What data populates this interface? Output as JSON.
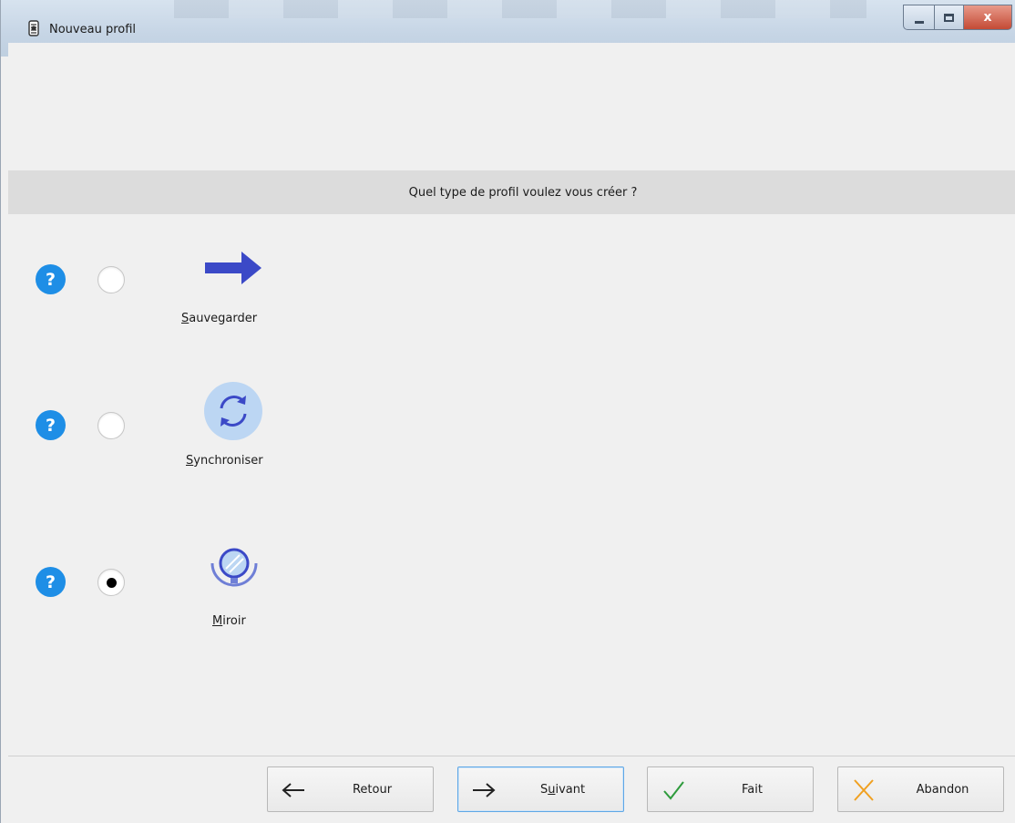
{
  "window": {
    "title": "Nouveau profil",
    "controls": {
      "close_glyph": "x"
    }
  },
  "question": "Quel type de profil voulez vous créer ?",
  "options": [
    {
      "id": "sauvegarder",
      "label_first": "S",
      "label_rest": "auvegarder",
      "icon": "arrow-right-icon",
      "selected": false
    },
    {
      "id": "synchroniser",
      "label_first": "S",
      "label_rest": "ynchroniser",
      "icon": "sync-icon",
      "selected": false
    },
    {
      "id": "miroir",
      "label_first": "M",
      "label_rest": "iroir",
      "icon": "mirror-icon",
      "selected": true
    }
  ],
  "help_glyph": "?",
  "buttons": {
    "back": {
      "label": "Retour",
      "icon": "arrow-left-icon"
    },
    "next": {
      "label_pre": "S",
      "label_u": "u",
      "label_post": "ivant",
      "icon": "arrow-right-icon"
    },
    "done": {
      "label": "Fait",
      "icon": "check-icon"
    },
    "abort": {
      "label": "Abandon",
      "icon": "close-icon"
    }
  },
  "colors": {
    "help_blue": "#1e8ee6",
    "arrow_blue": "#3b49c7",
    "done_green": "#2e9b3c",
    "abort_orange": "#f0a020"
  }
}
